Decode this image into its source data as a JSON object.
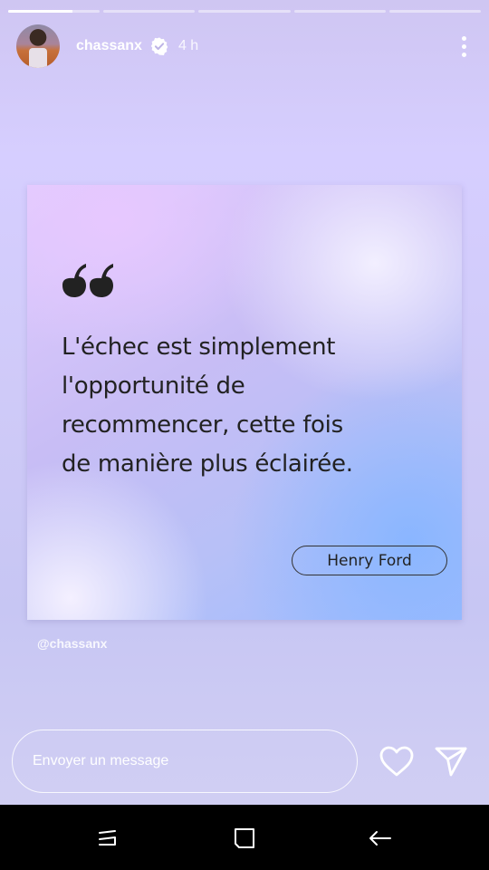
{
  "story": {
    "segments": [
      {
        "fill": 0.7
      },
      {
        "fill": 0
      },
      {
        "fill": 0
      },
      {
        "fill": 0
      },
      {
        "fill": 0
      }
    ]
  },
  "header": {
    "username": "chassanx",
    "time": "4 h",
    "verified_icon": "verified-badge-icon",
    "more_icon": "more-vertical-icon"
  },
  "post": {
    "quote_icon": "quotation-mark-icon",
    "quote_lines": [
      "L'échec est simplement",
      "l'opportunité de",
      "recommencer, cette fois",
      "de manière plus éclairée."
    ],
    "author": "Henry Ford",
    "watermark": "@chassanx"
  },
  "footer": {
    "message_placeholder": "Envoyer un message",
    "like_icon": "heart-icon",
    "send_icon": "send-icon"
  },
  "navbar": {
    "recents_icon": "recents-icon",
    "home_icon": "home-icon",
    "back_icon": "back-icon"
  },
  "colors": {
    "background": "#cfc6f2",
    "text_dark": "#222222",
    "white": "#ffffff",
    "navbar": "#000000"
  }
}
